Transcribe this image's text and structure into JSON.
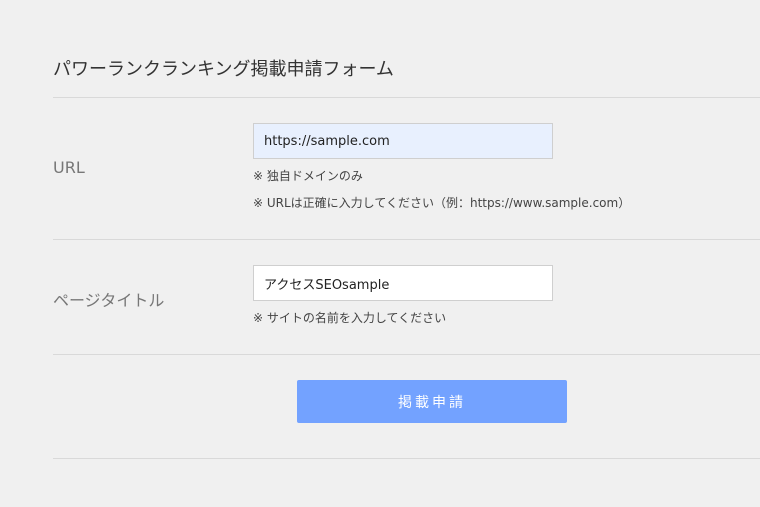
{
  "form": {
    "title": "パワーランクランキング掲載申請フォーム"
  },
  "fields": {
    "url": {
      "label": "URL",
      "value": "https://sample.com",
      "notes": [
        "※ 独自ドメインのみ",
        "※ URLは正確に入力してください（例：https://www.sample.com）"
      ]
    },
    "page_title": {
      "label": "ページタイトル",
      "value": "アクセスSEOsample",
      "notes": [
        "※ サイトの名前を入力してください"
      ]
    }
  },
  "submit": {
    "label": "掲載申請"
  },
  "colors": {
    "background": "#f0f0f0",
    "autofill_input": "#e8f0fe",
    "button": "#73a2ff",
    "divider": "#d9d9d9"
  }
}
